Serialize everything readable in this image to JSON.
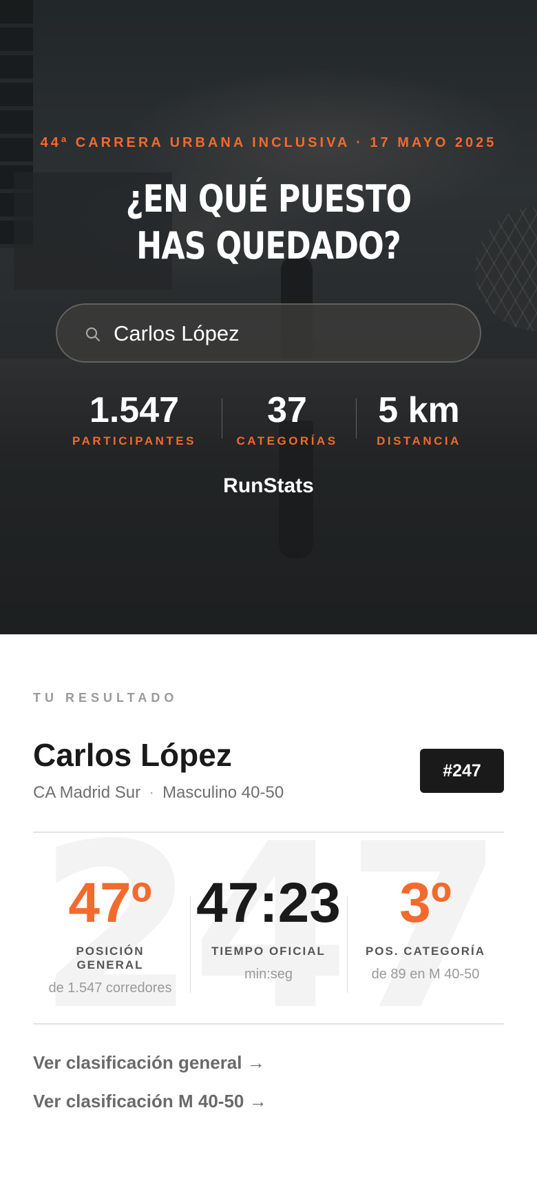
{
  "hero": {
    "event_line": "44ª CARRERA URBANA INCLUSIVA · 17 MAYO 2025",
    "title": "¿EN QUÉ PUESTO HAS QUEDADO?",
    "search": {
      "value": "Carlos López",
      "icon": "search-icon"
    },
    "stats": [
      {
        "value": "1.547",
        "label": "PARTICIPANTES"
      },
      {
        "value": "37",
        "label": "CATEGORÍAS"
      },
      {
        "value": "5 km",
        "label": "DISTANCIA"
      }
    ],
    "brand": "RunStats"
  },
  "result": {
    "section_label": "TU RESULTADO",
    "runner": {
      "name": "Carlos López",
      "club": "CA Madrid Sur",
      "separator": "·",
      "category": "Masculino 40-50"
    },
    "bib": "#247",
    "watermark": "247",
    "metrics": [
      {
        "value": "47º",
        "caption": "POSICIÓN GENERAL",
        "sub": "de 1.547 corredores"
      },
      {
        "value": "47:23",
        "caption": "TIEMPO OFICIAL",
        "sub": "min:seg"
      },
      {
        "value": "3º",
        "caption": "POS. CATEGORÍA",
        "sub": "de 89 en M 40-50"
      }
    ],
    "links": [
      {
        "label": "Ver clasificación general →"
      },
      {
        "label": "Ver clasificación M 40-50 →"
      }
    ]
  },
  "colors": {
    "accent": "#f26a2e",
    "dark": "#1a1a1a",
    "muted": "#9a9a9a"
  }
}
